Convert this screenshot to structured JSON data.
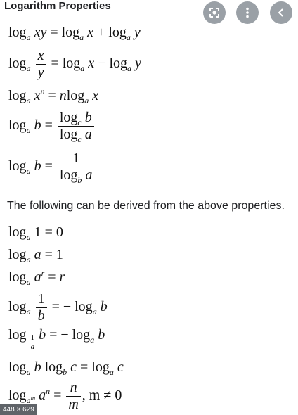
{
  "header": {
    "title": "Logarithm Properties"
  },
  "toolbar": {
    "lens_icon": "google-lens-icon",
    "more_icon": "more-vertical-icon",
    "back_icon": "chevron-left-icon"
  },
  "sentence": "The following can be derived from the above properties.",
  "badge": "448 × 629",
  "formulas": {
    "f1": {
      "lhs": "log",
      "base": "a",
      "arg": "xy",
      "eq": "=",
      "t1": "log",
      "b1": "a",
      "a1": "x",
      "op": "+",
      "t2": "log",
      "b2": "a",
      "a2": "y"
    },
    "f2": {
      "lhs": "log",
      "base": "a",
      "num": "x",
      "den": "y",
      "eq": "=",
      "t1": "log",
      "b1": "a",
      "a1": "x",
      "op": "−",
      "t2": "log",
      "b2": "a",
      "a2": "y"
    },
    "f3": {
      "lhs": "log",
      "base": "a",
      "arg": "x",
      "exp": "n",
      "eq": "=",
      "coef": "n",
      "t1": "log",
      "b1": "a",
      "a1": "x"
    },
    "f4": {
      "lhs": "log",
      "base": "a",
      "arg": "b",
      "eq": "=",
      "nlog": "log",
      "nb": "c",
      "narg": "b",
      "dlog": "log",
      "db": "c",
      "darg": "a"
    },
    "f5": {
      "lhs": "log",
      "base": "a",
      "arg": "b",
      "eq": "=",
      "num": "1",
      "dlog": "log",
      "db": "b",
      "darg": "a"
    },
    "g1": {
      "lhs": "log",
      "base": "a",
      "arg": "1",
      "eq": "=",
      "rhs": "0"
    },
    "g2": {
      "lhs": "log",
      "base": "a",
      "arg": "a",
      "eq": "=",
      "rhs": "1"
    },
    "g3": {
      "lhs": "log",
      "base": "a",
      "arg": "a",
      "exp": "r",
      "eq": "=",
      "rhs": "r"
    },
    "g4": {
      "lhs": "log",
      "base": "a",
      "num": "1",
      "den": "b",
      "eq": "= −",
      "t1": "log",
      "b1": "a",
      "a1": "b"
    },
    "g5": {
      "lhs": "log",
      "bnum": "1",
      "bden": "a",
      "arg": "b",
      "eq": "= −",
      "t1": "log",
      "b1": "a",
      "a1": "b"
    },
    "g6": {
      "l1": "log",
      "b1": "a",
      "a1": "b",
      "l2": "log",
      "b2": "b",
      "a2": "c",
      "eq": "=",
      "l3": "log",
      "b3": "a",
      "a3": "c"
    },
    "g7": {
      "lhs": "log",
      "base": "a",
      "bexp": "m",
      "arg": "a",
      "exp": "n",
      "eq": "=",
      "num": "n",
      "den": "m",
      "cond": ", m ≠ 0"
    }
  }
}
